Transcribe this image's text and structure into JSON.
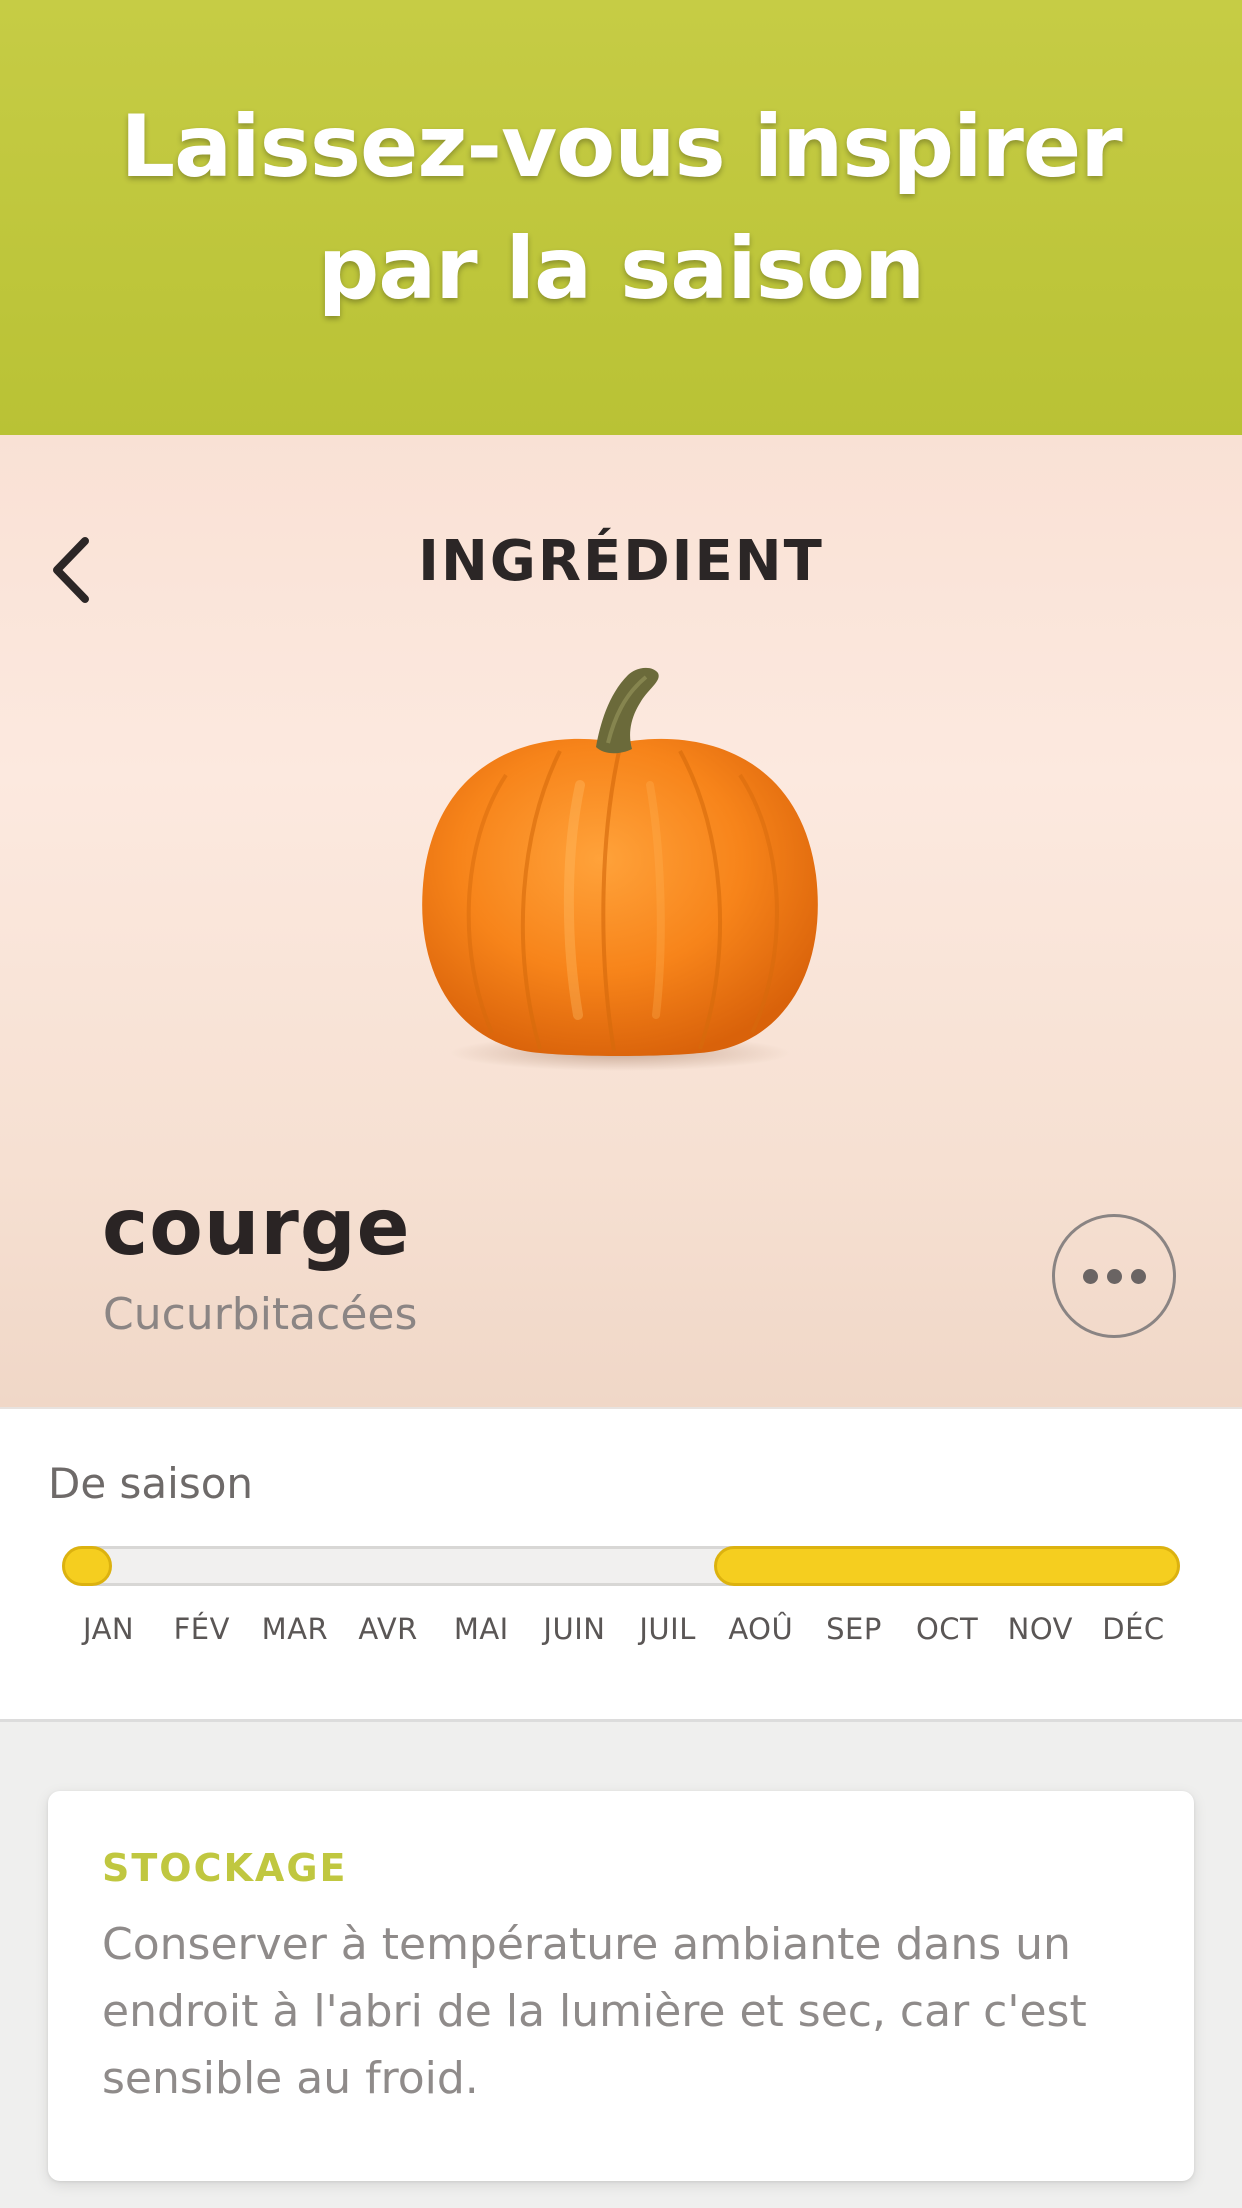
{
  "banner": {
    "title": "Laissez-vous inspirer par la saison",
    "background_color": "#c2c83e"
  },
  "header": {
    "title": "INGRÉDIENT",
    "back_icon": "chevron-left-icon"
  },
  "ingredient": {
    "name": "courge",
    "family": "Cucurbitacées",
    "image": "pumpkin",
    "more_icon": "more-horizontal-icon"
  },
  "season": {
    "label": "De saison",
    "months": [
      "JAN",
      "FÉV",
      "MAR",
      "AVR",
      "MAI",
      "JUIN",
      "JUIL",
      "AOÛ",
      "SEP",
      "OCT",
      "NOV",
      "DÉC"
    ],
    "in_season_months": [
      "JAN",
      "AOÛ",
      "SEP",
      "OCT",
      "NOV",
      "DÉC"
    ],
    "highlight_color": "#f5ce1f"
  },
  "storage": {
    "title": "STOCKAGE",
    "text": "Conserver à température ambiante dans un endroit à l'abri de la lumière et sec, car c'est sensible au froid.",
    "title_color": "#c0c740"
  }
}
